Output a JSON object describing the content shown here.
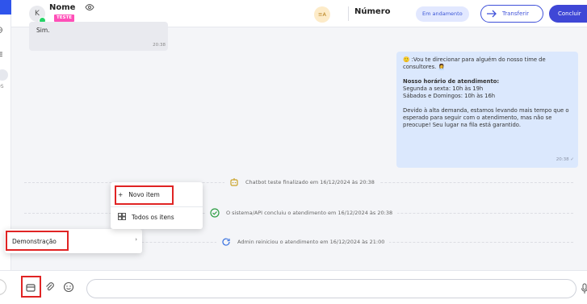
{
  "header": {
    "avatar_initial": "K",
    "contact_name": "Nome",
    "tag": "TESTE",
    "queue_label": "≡A",
    "field_label": "Número",
    "status": "Em andamento",
    "transfer_label": "Transferir",
    "finish_label": "Concluir"
  },
  "rail": {
    "partial_text": "OS"
  },
  "messages": {
    "incoming": {
      "text": "Sim.",
      "time": "20:38"
    },
    "outgoing": {
      "line1": "🙂 :Vou te direcionar para alguém do nosso time de consultores. 👩‍💼",
      "hours_title": "Nosso horário de atendimento:",
      "hours_weekdays": "Segunda a sexta: 10h às 19h",
      "hours_weekend": "Sábados e Domingos: 10h às 16h",
      "notice": "Devido à alta demanda, estamos levando mais tempo que o esperado para seguir com o atendimento, mas não se preocupe! Seu lugar na fila está garantido.",
      "time": "20:38 ✓"
    }
  },
  "system": {
    "chatbot_ended": "Chatbot teste finalizado em 16/12/2024 às 20:38",
    "api_completed": "O sistema/API concluiu o atendimento em 16/12/2024 às 20:38",
    "admin_restarted": "Admin reiniciou o atendimento em 16/12/2024 às 21:00"
  },
  "context_menu": {
    "item": "Demonstração"
  },
  "submenu": {
    "new_item": "Novo item",
    "all_items": "Todos os itens"
  },
  "composer": {
    "placeholder": ""
  },
  "colors": {
    "primary": "#3f47d6",
    "highlight": "#e02424",
    "tag": "#ff4fb8",
    "outgoing_bubble": "#dbe8fd"
  }
}
